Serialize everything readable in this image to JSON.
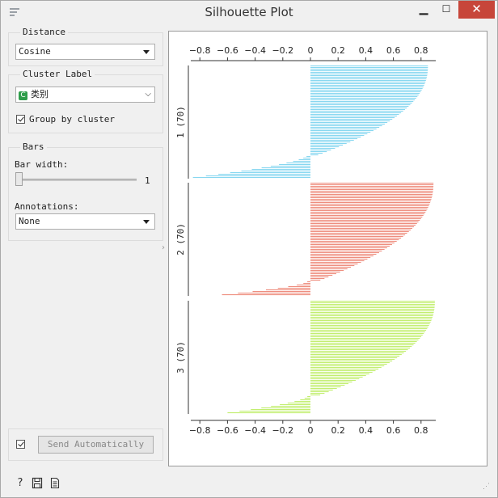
{
  "window": {
    "title": "Silhouette Plot"
  },
  "distance": {
    "section": "Distance",
    "value": "Cosine"
  },
  "cluster_label": {
    "section": "Cluster Label",
    "badge": "C",
    "value": "类别",
    "group_label": "Group by cluster"
  },
  "bars": {
    "section": "Bars",
    "bar_width_label": "Bar width:",
    "bar_width_value": "1",
    "annotations_label": "Annotations:",
    "annotations_value": "None"
  },
  "send": {
    "label": "Send Automatically"
  },
  "icons": {
    "help": "help-icon",
    "save": "save-icon",
    "report": "report-icon"
  },
  "chart_data": {
    "type": "bar",
    "orientation": "horizontal",
    "xlim": [
      -0.8,
      0.9
    ],
    "xticks": [
      "−0.8",
      "−0.6",
      "−0.4",
      "−0.2",
      "0",
      "0.2",
      "0.4",
      "0.6",
      "0.8"
    ],
    "xtick_values": [
      -0.8,
      -0.6,
      -0.4,
      -0.2,
      0,
      0.2,
      0.4,
      0.6,
      0.8
    ],
    "clusters": [
      {
        "label": "1 (70)",
        "color": "#87d7f0",
        "min": -0.85,
        "max": 0.85,
        "count": 70
      },
      {
        "label": "2 (70)",
        "color": "#ee8d7e",
        "min": -0.64,
        "max": 0.89,
        "count": 70
      },
      {
        "label": "3 (70)",
        "color": "#c2ee70",
        "min": -0.6,
        "max": 0.9,
        "count": 70
      }
    ]
  }
}
